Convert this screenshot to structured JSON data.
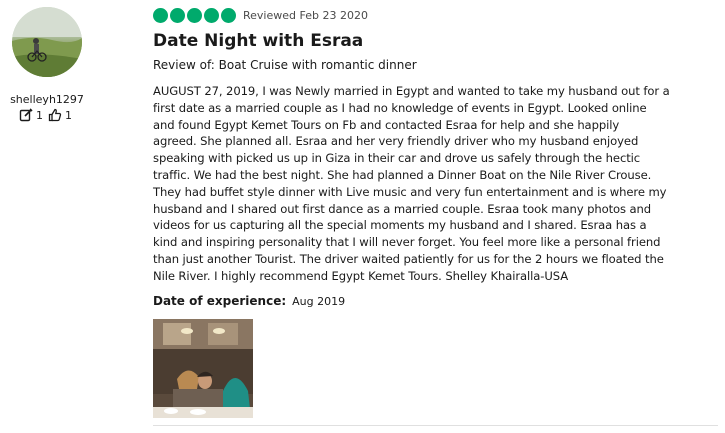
{
  "author": {
    "username": "shelleyh1297",
    "reviews_count": "1",
    "helpful_votes_count": "1",
    "avatar_icon": "user-avatar"
  },
  "review": {
    "rating_bubbles": 5,
    "rating_color": "#00aa6c",
    "reviewed_date": "Reviewed Feb 23 2020",
    "title": "Date Night with Esraa",
    "review_of": "Review of: Boat Cruise with romantic dinner",
    "body_lines": [
      "AUGUST 27, 2019, I was Newly married in Egypt and wanted to take my husband out for a",
      "first date as a married couple as I had no knowledge of events in Egypt. Looked online",
      "and found Egypt Kemet Tours on Fb and contacted Esraa for help and she happily",
      "agreed. She planned all. Esraa and her very friendly driver who my husband enjoyed",
      "speaking with picked us up in Giza in their car and drove us safely through the hectic",
      "traffic. We had the best night. She had planned a Dinner Boat on the Nile River Crouse.",
      "They had buffet style dinner with Live music and very fun entertainment and is where my",
      "husband and I shared out first dance as a married couple. Esraa took many photos and",
      "videos for us capturing all the special moments my husband and I shared. Esraa has a",
      "kind and inspiring personality that I will never forget. You feel more like a personal friend",
      "than just another Tourist. The driver waited patiently for us for the 2 hours we floated the",
      "Nile River. I highly recommend Egypt Kemet Tours. Shelley Khairalla-USA"
    ],
    "date_of_experience_label": "Date of experience:",
    "date_of_experience_value": "Aug 2019"
  }
}
